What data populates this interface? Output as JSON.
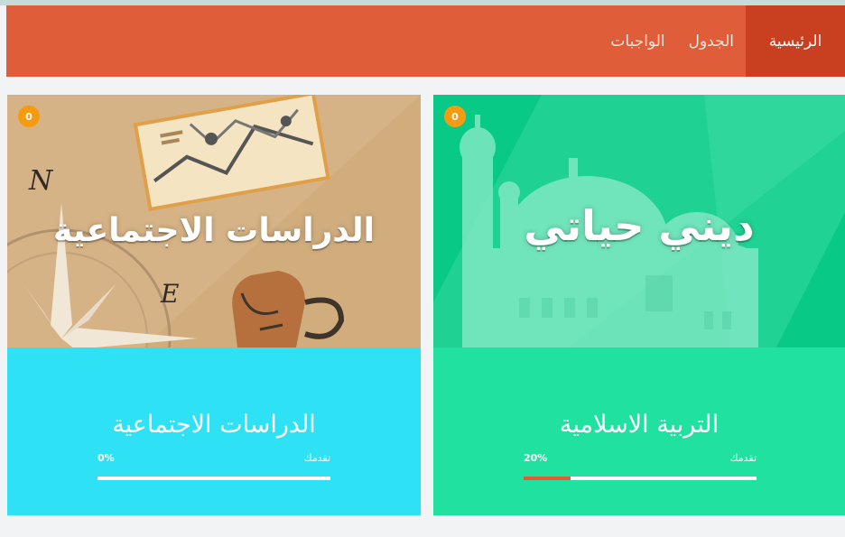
{
  "nav": {
    "items": [
      {
        "label": "الرئيسية",
        "active": true
      },
      {
        "label": "الجدول",
        "active": false
      },
      {
        "label": "الواجبات",
        "active": false
      }
    ]
  },
  "courses": [
    {
      "banner_text": "دیني حياتي",
      "badge": "0",
      "title": "التربية الاسلامية",
      "progress_label": "تقدمك",
      "progress_text": "20%",
      "progress": 20,
      "body_color": "#21e1a0",
      "image_color": "#08c986",
      "image_icon": "mosque-illustration"
    },
    {
      "banner_text": "الدراسات الاجتماعية",
      "badge": "0",
      "title": "الدراسات الاجتماعية",
      "progress_label": "تقدمك",
      "progress_text": "0%",
      "progress": 0,
      "body_color": "#2ee1f5",
      "image_color": "#d6b386",
      "image_icon": "map-compass-illustration"
    }
  ],
  "colors": {
    "nav": "#e05d3a",
    "nav_active": "#c8401f",
    "badge": "#f39c12",
    "progress_fill": "#e05d3a"
  }
}
